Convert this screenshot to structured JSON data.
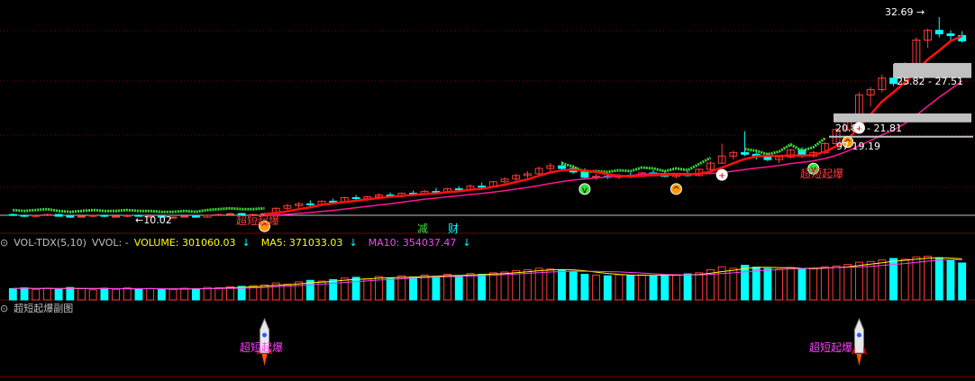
{
  "colors": {
    "background": "#000000",
    "up": "#ff3c3c",
    "down": "#00ffff",
    "ma_red": "#ff1010",
    "ma_pink": "#ff1493",
    "ma_green": "#3cdc3c",
    "vol_ma5": "#ffff00",
    "vol_ma10": "#ff40ff",
    "band": "#c0c0c0"
  },
  "main": {
    "price_labels": {
      "high": "32.69",
      "low": "10.02",
      "zone1": "25.82 - 27.51",
      "zone2": "20.81 - 21.81",
      "zone3": "97   19.19"
    },
    "signal_text": "超短起爆",
    "signal_text_left": "超短起爆",
    "bottom_glyphs": [
      "减",
      "财"
    ]
  },
  "volume_panel": {
    "name": "VOL-TDX(5,10)",
    "vvol": "VVOL: -",
    "volume": "VOLUME: 301060.03",
    "ma5": "MA5: 371033.03",
    "ma10": "MA10: 354037.47"
  },
  "sub_panel": {
    "name": "超短起爆副图",
    "signals": [
      "超短起爆",
      "超短起爆"
    ]
  },
  "chart_data": {
    "type": "candlestick",
    "ohlc": [
      [
        10.4,
        10.5,
        10.2,
        10.3
      ],
      [
        10.3,
        10.4,
        10.1,
        10.2
      ],
      [
        10.2,
        10.4,
        10.1,
        10.3
      ],
      [
        10.3,
        10.5,
        10.2,
        10.4
      ],
      [
        10.4,
        10.5,
        10.2,
        10.2
      ],
      [
        10.2,
        10.3,
        10.0,
        10.1
      ],
      [
        10.1,
        10.3,
        10.02,
        10.2
      ],
      [
        10.2,
        10.4,
        10.1,
        10.3
      ],
      [
        10.3,
        10.4,
        10.1,
        10.2
      ],
      [
        10.2,
        10.3,
        10.1,
        10.2
      ],
      [
        10.2,
        10.4,
        10.1,
        10.3
      ],
      [
        10.3,
        10.4,
        10.2,
        10.2
      ],
      [
        10.2,
        10.3,
        10.1,
        10.2
      ],
      [
        10.2,
        10.3,
        10.1,
        10.1
      ],
      [
        10.1,
        10.2,
        10.0,
        10.1
      ],
      [
        10.1,
        10.3,
        10.05,
        10.2
      ],
      [
        10.2,
        10.3,
        10.1,
        10.1
      ],
      [
        10.1,
        10.4,
        10.1,
        10.3
      ],
      [
        10.3,
        10.5,
        10.2,
        10.4
      ],
      [
        10.4,
        10.6,
        10.3,
        10.5
      ],
      [
        10.5,
        10.6,
        10.3,
        10.4
      ],
      [
        10.4,
        10.5,
        10.3,
        10.4
      ],
      [
        10.4,
        10.6,
        10.3,
        10.5
      ],
      [
        10.5,
        11.2,
        10.4,
        11.1
      ],
      [
        11.1,
        11.6,
        10.9,
        11.4
      ],
      [
        11.4,
        11.8,
        11.1,
        11.6
      ],
      [
        11.6,
        12.0,
        11.3,
        11.5
      ],
      [
        11.5,
        12.0,
        11.3,
        11.9
      ],
      [
        11.9,
        12.2,
        11.6,
        11.8
      ],
      [
        11.8,
        12.4,
        11.7,
        12.3
      ],
      [
        12.3,
        12.6,
        12.0,
        12.2
      ],
      [
        12.2,
        12.5,
        11.9,
        12.4
      ],
      [
        12.4,
        12.8,
        12.2,
        12.6
      ],
      [
        12.6,
        12.9,
        12.3,
        12.5
      ],
      [
        12.5,
        12.9,
        12.3,
        12.8
      ],
      [
        12.8,
        13.1,
        12.5,
        12.7
      ],
      [
        12.7,
        13.2,
        12.6,
        13.0
      ],
      [
        13.0,
        13.4,
        12.8,
        12.9
      ],
      [
        12.9,
        13.4,
        12.8,
        13.3
      ],
      [
        13.3,
        13.6,
        13.0,
        13.2
      ],
      [
        13.2,
        13.8,
        13.1,
        13.6
      ],
      [
        13.6,
        14.0,
        13.4,
        13.5
      ],
      [
        13.5,
        14.2,
        13.4,
        14.1
      ],
      [
        14.1,
        14.6,
        13.9,
        14.4
      ],
      [
        14.4,
        15.0,
        14.2,
        14.8
      ],
      [
        14.8,
        15.3,
        14.5,
        15.0
      ],
      [
        15.0,
        15.8,
        14.8,
        15.6
      ],
      [
        15.6,
        16.2,
        15.2,
        15.9
      ],
      [
        15.9,
        16.4,
        15.4,
        15.6
      ],
      [
        15.6,
        16.0,
        15.0,
        15.2
      ],
      [
        15.2,
        15.6,
        14.5,
        14.6
      ],
      [
        14.6,
        15.0,
        14.3,
        14.7
      ],
      [
        14.7,
        15.0,
        14.4,
        14.6
      ],
      [
        14.6,
        15.0,
        14.4,
        14.8
      ],
      [
        14.8,
        15.1,
        14.5,
        14.7
      ],
      [
        14.7,
        15.2,
        14.6,
        15.1
      ],
      [
        15.1,
        15.4,
        14.9,
        15.0
      ],
      [
        15.0,
        15.3,
        14.6,
        14.7
      ],
      [
        14.7,
        15.1,
        14.5,
        15.0
      ],
      [
        15.0,
        15.3,
        14.7,
        14.8
      ],
      [
        14.8,
        15.6,
        14.7,
        15.5
      ],
      [
        15.5,
        16.4,
        15.3,
        16.2
      ],
      [
        16.2,
        18.4,
        16.1,
        17.0
      ],
      [
        17.0,
        17.6,
        16.6,
        17.4
      ],
      [
        17.4,
        19.8,
        17.0,
        17.2
      ],
      [
        17.2,
        17.6,
        16.6,
        17.0
      ],
      [
        17.0,
        17.3,
        16.4,
        16.6
      ],
      [
        16.6,
        17.0,
        16.2,
        16.9
      ],
      [
        16.9,
        17.8,
        16.7,
        17.7
      ],
      [
        17.7,
        18.0,
        16.8,
        17.0
      ],
      [
        17.0,
        17.6,
        16.8,
        17.4
      ],
      [
        17.4,
        18.6,
        17.2,
        18.4
      ],
      [
        18.4,
        20.2,
        18.2,
        20.0
      ],
      [
        20.0,
        21.8,
        19.8,
        21.6
      ],
      [
        21.6,
        24.2,
        21.4,
        23.9
      ],
      [
        23.9,
        24.8,
        22.6,
        24.5
      ],
      [
        24.5,
        26.2,
        24.2,
        25.8
      ],
      [
        25.8,
        27.4,
        24.9,
        25.2
      ],
      [
        25.2,
        27.6,
        25.0,
        27.3
      ],
      [
        27.3,
        30.4,
        27.0,
        30.1
      ],
      [
        30.1,
        31.4,
        29.2,
        31.2
      ],
      [
        31.2,
        32.69,
        30.4,
        30.8
      ],
      [
        30.8,
        31.2,
        30.0,
        30.6
      ],
      [
        30.6,
        31.1,
        29.8,
        30.0
      ]
    ],
    "volume": [
      3000,
      3200,
      2800,
      3100,
      2900,
      3300,
      3000,
      2700,
      3100,
      2800,
      3200,
      2900,
      3000,
      2700,
      2800,
      3100,
      3000,
      3300,
      3200,
      3500,
      3600,
      3800,
      4000,
      4500,
      4200,
      4800,
      5200,
      5000,
      5400,
      5800,
      6000,
      5600,
      6200,
      5800,
      6400,
      6100,
      6600,
      6300,
      6800,
      6500,
      7000,
      6800,
      7200,
      7400,
      7800,
      8000,
      8400,
      8200,
      7900,
      7400,
      6800,
      6600,
      6400,
      6700,
      6500,
      6600,
      6400,
      6500,
      6700,
      6900,
      7200,
      8000,
      8800,
      8400,
      9200,
      8700,
      8300,
      8100,
      8600,
      8200,
      8400,
      8800,
      9000,
      9400,
      10000,
      10200,
      10600,
      11000,
      10800,
      11400,
      11600,
      11200,
      10400,
      9800
    ],
    "vol_ma5": [],
    "vol_ma10": [],
    "xlabel": "",
    "ylabel": ""
  }
}
